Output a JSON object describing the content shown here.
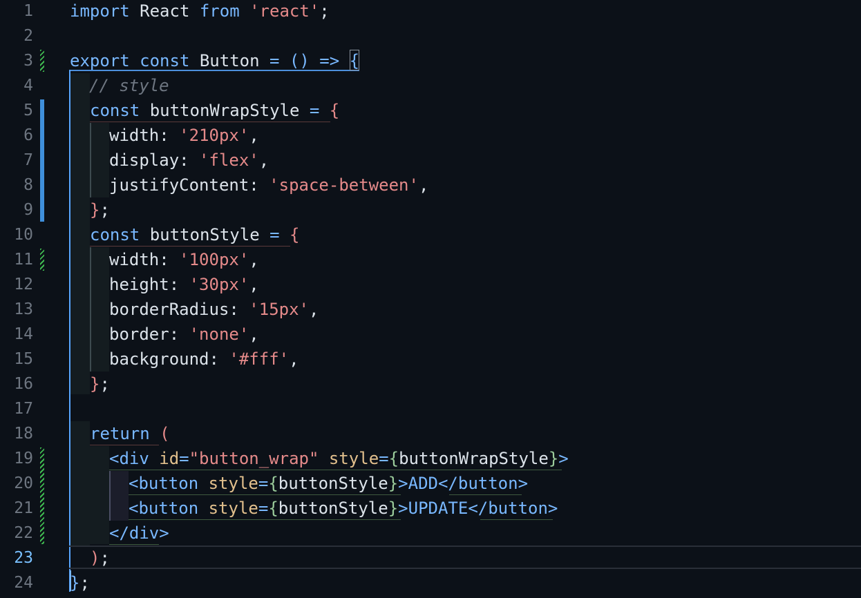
{
  "editor": {
    "active_line": "23",
    "line_numbers": [
      "1",
      "2",
      "3",
      "4",
      "5",
      "6",
      "7",
      "8",
      "9",
      "10",
      "11",
      "12",
      "13",
      "14",
      "15",
      "16",
      "17",
      "18",
      "19",
      "20",
      "21",
      "22",
      "23",
      "24"
    ],
    "lines": {
      "l1": [
        "import",
        " React ",
        "from",
        " ",
        "'react'",
        ";"
      ],
      "l3": [
        "export",
        " ",
        "const",
        " Button ",
        "=",
        " ",
        "()",
        " ",
        "=>",
        " ",
        "{"
      ],
      "l4": [
        "// style"
      ],
      "l5": [
        "const",
        " buttonWrapStyle ",
        "=",
        " ",
        "{"
      ],
      "l6": [
        "width: ",
        "'210px'",
        ","
      ],
      "l7": [
        "display: ",
        "'flex'",
        ","
      ],
      "l8": [
        "justifyContent: ",
        "'space-between'",
        ","
      ],
      "l9": [
        "}",
        ";"
      ],
      "l10": [
        "const",
        " buttonStyle ",
        "=",
        " ",
        "{"
      ],
      "l11": [
        "width: ",
        "'100px'",
        ","
      ],
      "l12": [
        "height: ",
        "'30px'",
        ","
      ],
      "l13": [
        "borderRadius: ",
        "'15px'",
        ","
      ],
      "l14": [
        "border: ",
        "'none'",
        ","
      ],
      "l15": [
        "background: ",
        "'#fff'",
        ","
      ],
      "l16": [
        "}",
        ";"
      ],
      "l18": [
        "return",
        " ",
        "("
      ],
      "l19": [
        "<div",
        " ",
        "id",
        "=",
        "\"button_wrap\"",
        " ",
        "style",
        "=",
        "{",
        "buttonWrapStyle",
        "}",
        ">"
      ],
      "l20": [
        "<button",
        " ",
        "style",
        "=",
        "{",
        "buttonStyle",
        "}",
        ">ADD</button>"
      ],
      "l21": [
        "<button",
        " ",
        "style",
        "=",
        "{",
        "buttonStyle",
        "}",
        ">UPDATE</button>"
      ],
      "l22": [
        "</div>"
      ],
      "l23": [
        ")",
        ";"
      ],
      "l24": [
        "}",
        ";"
      ]
    }
  }
}
